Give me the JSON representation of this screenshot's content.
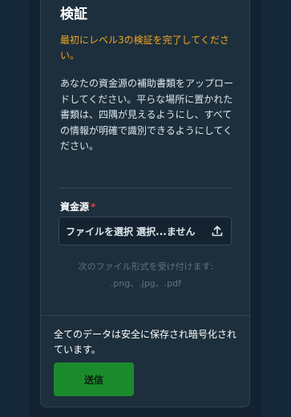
{
  "verification": {
    "title": "検証",
    "warning": "最初にレベル3の検証を完了してください。",
    "description": "あなたの資金源の補助書類をアップロードしてください。平らな場所に置かれた書類は、四隅が見えるようにし、すべての情報が明確で識別できるようにしてください。"
  },
  "upload": {
    "label": "資金源",
    "required_mark": "*",
    "button_text": "ファイルを選択 選択...ません",
    "accept_note_line1": "次のファイル形式を受け付けます:",
    "accept_note_line2": ".png、.jpg、.pdf"
  },
  "footer": {
    "secure_note": "全てのデータは安全に保存され暗号化されています。",
    "submit_label": "送信"
  },
  "colors": {
    "accent_warning": "#f2a623",
    "submit_bg": "#1b8a2c",
    "required": "#e0424a"
  },
  "icons": {
    "upload": "upload-icon"
  }
}
